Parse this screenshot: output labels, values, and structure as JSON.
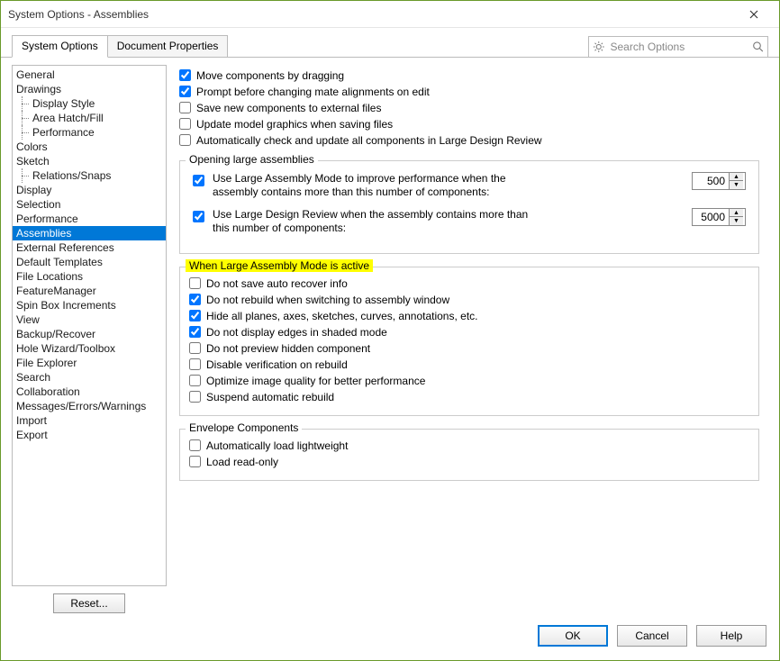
{
  "window": {
    "title": "System Options - Assemblies"
  },
  "tabs": {
    "system_options": "System Options",
    "document_properties": "Document Properties"
  },
  "search": {
    "placeholder": "Search Options"
  },
  "sidebar": {
    "items": [
      {
        "label": "General"
      },
      {
        "label": "Drawings"
      },
      {
        "label": "Display Style",
        "child": true
      },
      {
        "label": "Area Hatch/Fill",
        "child": true
      },
      {
        "label": "Performance",
        "child": true
      },
      {
        "label": "Colors"
      },
      {
        "label": "Sketch"
      },
      {
        "label": "Relations/Snaps",
        "child": true
      },
      {
        "label": "Display"
      },
      {
        "label": "Selection"
      },
      {
        "label": "Performance"
      },
      {
        "label": "Assemblies",
        "selected": true
      },
      {
        "label": "External References"
      },
      {
        "label": "Default Templates"
      },
      {
        "label": "File Locations"
      },
      {
        "label": "FeatureManager"
      },
      {
        "label": "Spin Box Increments"
      },
      {
        "label": "View"
      },
      {
        "label": "Backup/Recover"
      },
      {
        "label": "Hole Wizard/Toolbox"
      },
      {
        "label": "File Explorer"
      },
      {
        "label": "Search"
      },
      {
        "label": "Collaboration"
      },
      {
        "label": "Messages/Errors/Warnings"
      },
      {
        "label": "Import"
      },
      {
        "label": "Export"
      }
    ],
    "reset": "Reset..."
  },
  "top_checks": [
    {
      "label": "Move components by dragging",
      "checked": true
    },
    {
      "label": "Prompt before changing mate alignments on edit",
      "checked": true
    },
    {
      "label": "Save new components to external files",
      "checked": false
    },
    {
      "label": "Update model graphics when saving files",
      "checked": false
    },
    {
      "label": "Automatically check and update all components in Large Design Review",
      "checked": false
    }
  ],
  "group_opening": {
    "legend": "Opening large assemblies",
    "row1": {
      "label": "Use Large Assembly Mode to improve performance when the assembly contains more than this number of components:",
      "checked": true,
      "value": "500"
    },
    "row2": {
      "label": "Use Large Design Review when the assembly contains more than this number of components:",
      "checked": true,
      "value": "5000"
    }
  },
  "group_active": {
    "legend": "When Large Assembly Mode is active",
    "checks": [
      {
        "label": "Do not save auto recover info",
        "checked": false
      },
      {
        "label": "Do not rebuild when switching to assembly window",
        "checked": true
      },
      {
        "label": "Hide all planes, axes, sketches, curves, annotations, etc.",
        "checked": true
      },
      {
        "label": "Do not display edges in shaded mode",
        "checked": true
      },
      {
        "label": "Do not preview hidden component",
        "checked": false
      },
      {
        "label": "Disable verification on rebuild",
        "checked": false
      },
      {
        "label": "Optimize image quality for better performance",
        "checked": false
      },
      {
        "label": "Suspend automatic rebuild",
        "checked": false
      }
    ]
  },
  "group_envelope": {
    "legend": "Envelope Components",
    "checks": [
      {
        "label": "Automatically load lightweight",
        "checked": false
      },
      {
        "label": "Load read-only",
        "checked": false
      }
    ]
  },
  "footer": {
    "ok": "OK",
    "cancel": "Cancel",
    "help": "Help"
  }
}
